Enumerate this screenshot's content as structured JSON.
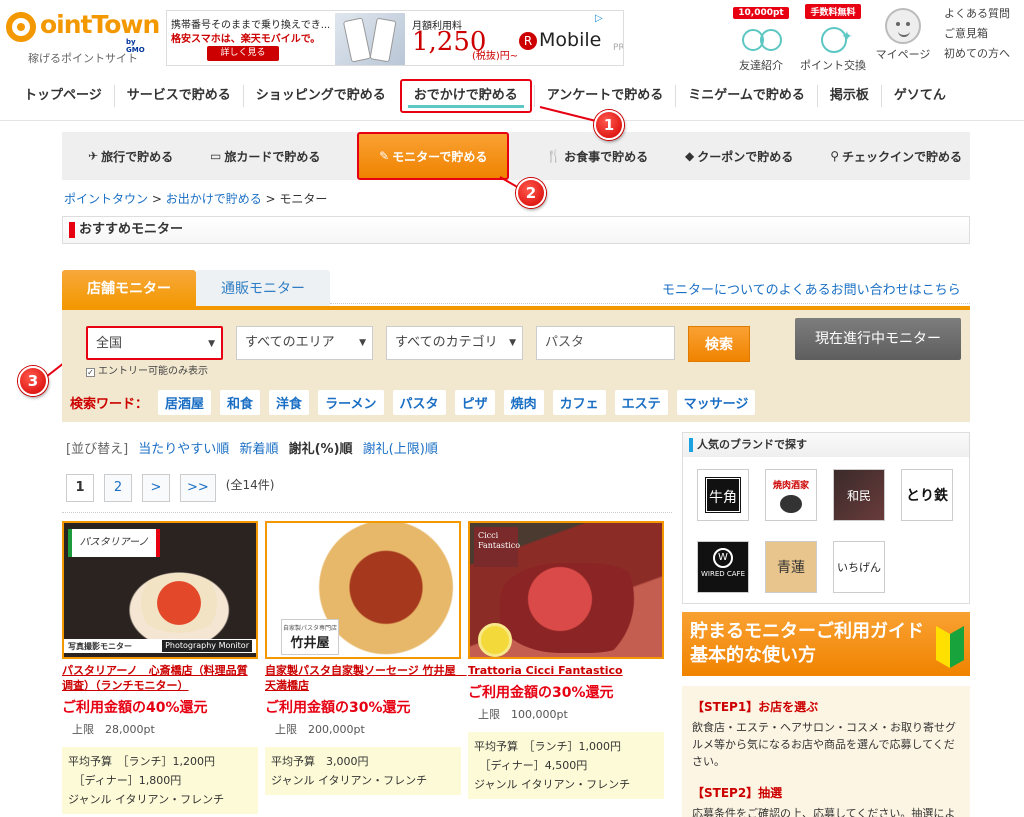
{
  "header": {
    "logo_text": "ointTown",
    "logo_gmo": "by GMO",
    "logo_sub": "稼げるポイントサイト",
    "ad": {
      "line1": "携帯番号そのままで乗り換えでき...",
      "line2": "格安スマホは、楽天モバイルで。",
      "button": "詳しく見る",
      "plan": "月額利用料",
      "price": "1,250",
      "yen": "(税抜)円~",
      "brand": "Mobile",
      "brand_r": "R",
      "pr": "PR"
    },
    "icons": [
      {
        "badge": "10,000pt",
        "label": "友達紹介"
      },
      {
        "badge": "手数料無料",
        "label": "ポイント交換"
      },
      {
        "badge": "",
        "label": "マイページ"
      }
    ],
    "links": [
      "よくある質問",
      "ご意見箱",
      "初めての方へ"
    ]
  },
  "mainnav": [
    "トップページ",
    "サービスで貯める",
    "ショッピングで貯める",
    "おでかけで貯める",
    "アンケートで貯める",
    "ミニゲームで貯める",
    "掲示板",
    "ゲソてん"
  ],
  "subnav": [
    {
      "icon": "✈",
      "label": "旅行で貯める"
    },
    {
      "icon": "▭",
      "label": "旅カードで貯める"
    },
    {
      "icon": "✎",
      "label": "モニターで貯める"
    },
    {
      "icon": "🍴",
      "label": "お食事で貯める"
    },
    {
      "icon": "◆",
      "label": "クーポンで貯める"
    },
    {
      "icon": "⚲",
      "label": "チェックインで貯める"
    }
  ],
  "callouts": [
    "1",
    "2",
    "3"
  ],
  "breadcrumb": {
    "home": "ポイントタウン",
    "sep": " > ",
    "parent": "お出かけで貯める",
    "current": "モニター"
  },
  "section_title": "おすすめモニター",
  "tabs": {
    "store": "店舗モニター",
    "mail": "通販モニター"
  },
  "faq_link": "モニターについてのよくあるお問い合わせはこちら",
  "search": {
    "region": "全国",
    "area": "すべてのエリア",
    "category": "すべてのカテゴリ",
    "keyword_value": "パスタ",
    "search_button": "検索",
    "current_button": "現在進行中モニター",
    "entry_only": "エントリー可能のみ表示",
    "entry_mark": "✓",
    "keyword_label": "検索ワード：",
    "keywords": [
      "居酒屋",
      "和食",
      "洋食",
      "ラーメン",
      "パスタ",
      "ピザ",
      "焼肉",
      "カフェ",
      "エステ",
      "マッサージ"
    ]
  },
  "sort": {
    "label": "[並び替え]",
    "options": [
      "当たりやすい順",
      "新着順",
      "謝礼(%)順",
      "謝礼(上限)順"
    ]
  },
  "pager": {
    "pages": [
      "1",
      "2",
      ">",
      ">>"
    ],
    "total": "(全14件)"
  },
  "cards": [
    {
      "photo_board": "パスタリアーノ",
      "photo_bar": "写真撮影モニター",
      "photo_pm": "Photography Monitor",
      "title": "パスタリアーノ　心斎橋店（料理品質调査）（ランチモニター）",
      "rate": "ご利用金額の40%還元",
      "cap": "上限　28,000pt",
      "info": [
        "平均予算　［ランチ］1,200円",
        "　［ディナー］1,800円",
        "ジャンル イタリアン・フレンチ"
      ]
    },
    {
      "photo_sign_small": "自家製パスタ専門店",
      "photo_sign": "竹井屋",
      "title": "自家製パスタ自家製ソーセージ 竹井屋　天満橋店",
      "rate": "ご利用金額の30%還元",
      "cap": "上限　200,000pt",
      "info": [
        "平均予算　3,000円",
        "ジャンル イタリアン・フレンチ"
      ]
    },
    {
      "photo_logo": "Cicci Fantastico",
      "title": "Trattoria Cicci Fantastico",
      "rate": "ご利用金額の30%還元",
      "cap": "上限　100,000pt",
      "info": [
        "平均予算　［ランチ］1,000円",
        "　［ディナー］4,500円",
        "ジャンル イタリアン・フレンチ"
      ]
    }
  ],
  "brands": {
    "title": "人気のブランドで探す",
    "b1": "牛角",
    "b2": "焼肉酒家",
    "b3": "和民",
    "b4": "とり鉄",
    "b5_mark": "W",
    "b5": "WIRED CAFE",
    "b6": "青蓮",
    "b7": "いちげん"
  },
  "guide": {
    "line1": "貯まるモニターご利用ガイド",
    "line2": "基本的な使い方"
  },
  "steps": [
    {
      "title": "【STEP1】お店を選ぶ",
      "desc": "飲食店・エステ・ヘアサロン・コスメ・お取り寄せグルメ等から気になるお店や商品を選んで応募してください。"
    },
    {
      "title": "【STEP2】抽選",
      "desc": "応募条件をご確認の上、応募してください。抽選によ"
    }
  ]
}
